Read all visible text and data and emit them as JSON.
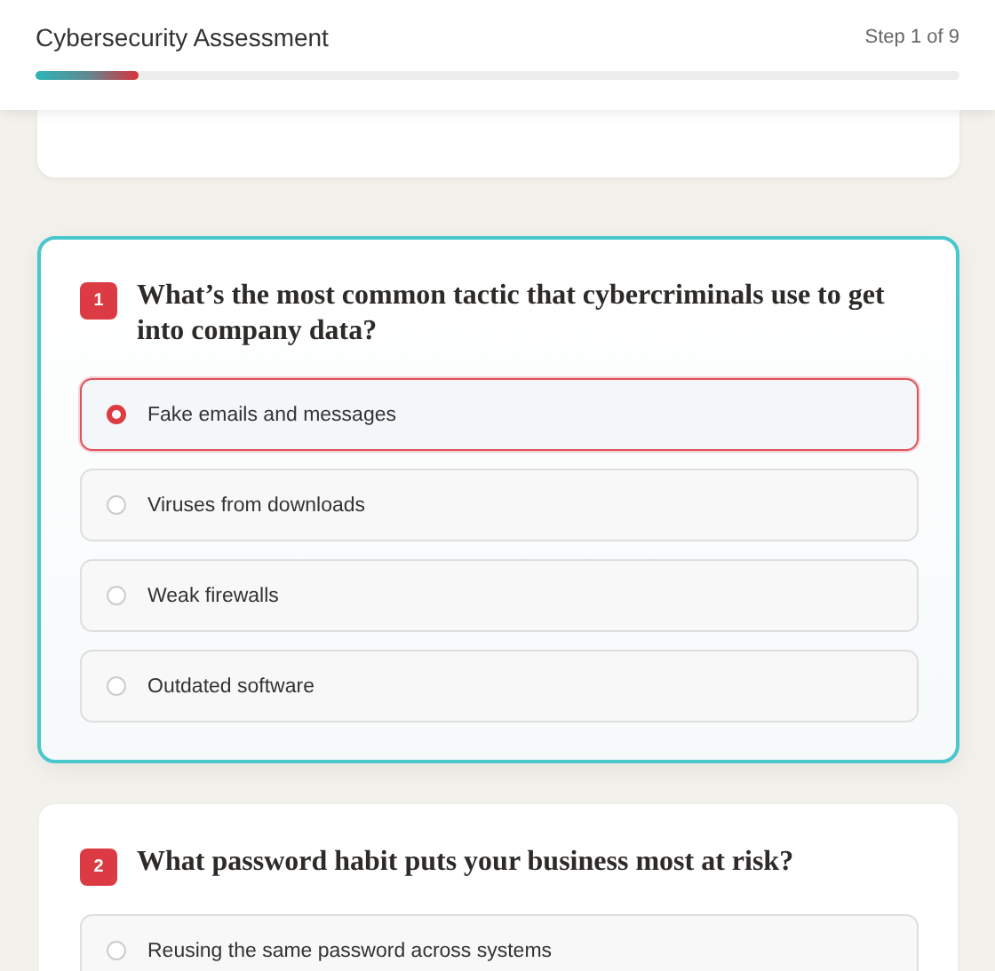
{
  "header": {
    "title": "Cybersecurity Assessment",
    "step": "Step 1 of 9",
    "progress": {
      "level": 0.111
    }
  },
  "questions": [
    {
      "number": "1",
      "text": "What’s the most common tactic that cybercriminals use to get into company data?",
      "active": true,
      "options": [
        {
          "label": "Fake emails and messages",
          "selected": true
        },
        {
          "label": "Viruses from downloads",
          "selected": false
        },
        {
          "label": "Weak firewalls",
          "selected": false
        },
        {
          "label": "Outdated software",
          "selected": false
        }
      ]
    },
    {
      "number": "2",
      "text": "What password habit puts your business most at risk?",
      "active": false,
      "options": [
        {
          "label": "Reusing the same password across systems",
          "selected": false
        }
      ]
    }
  ]
}
